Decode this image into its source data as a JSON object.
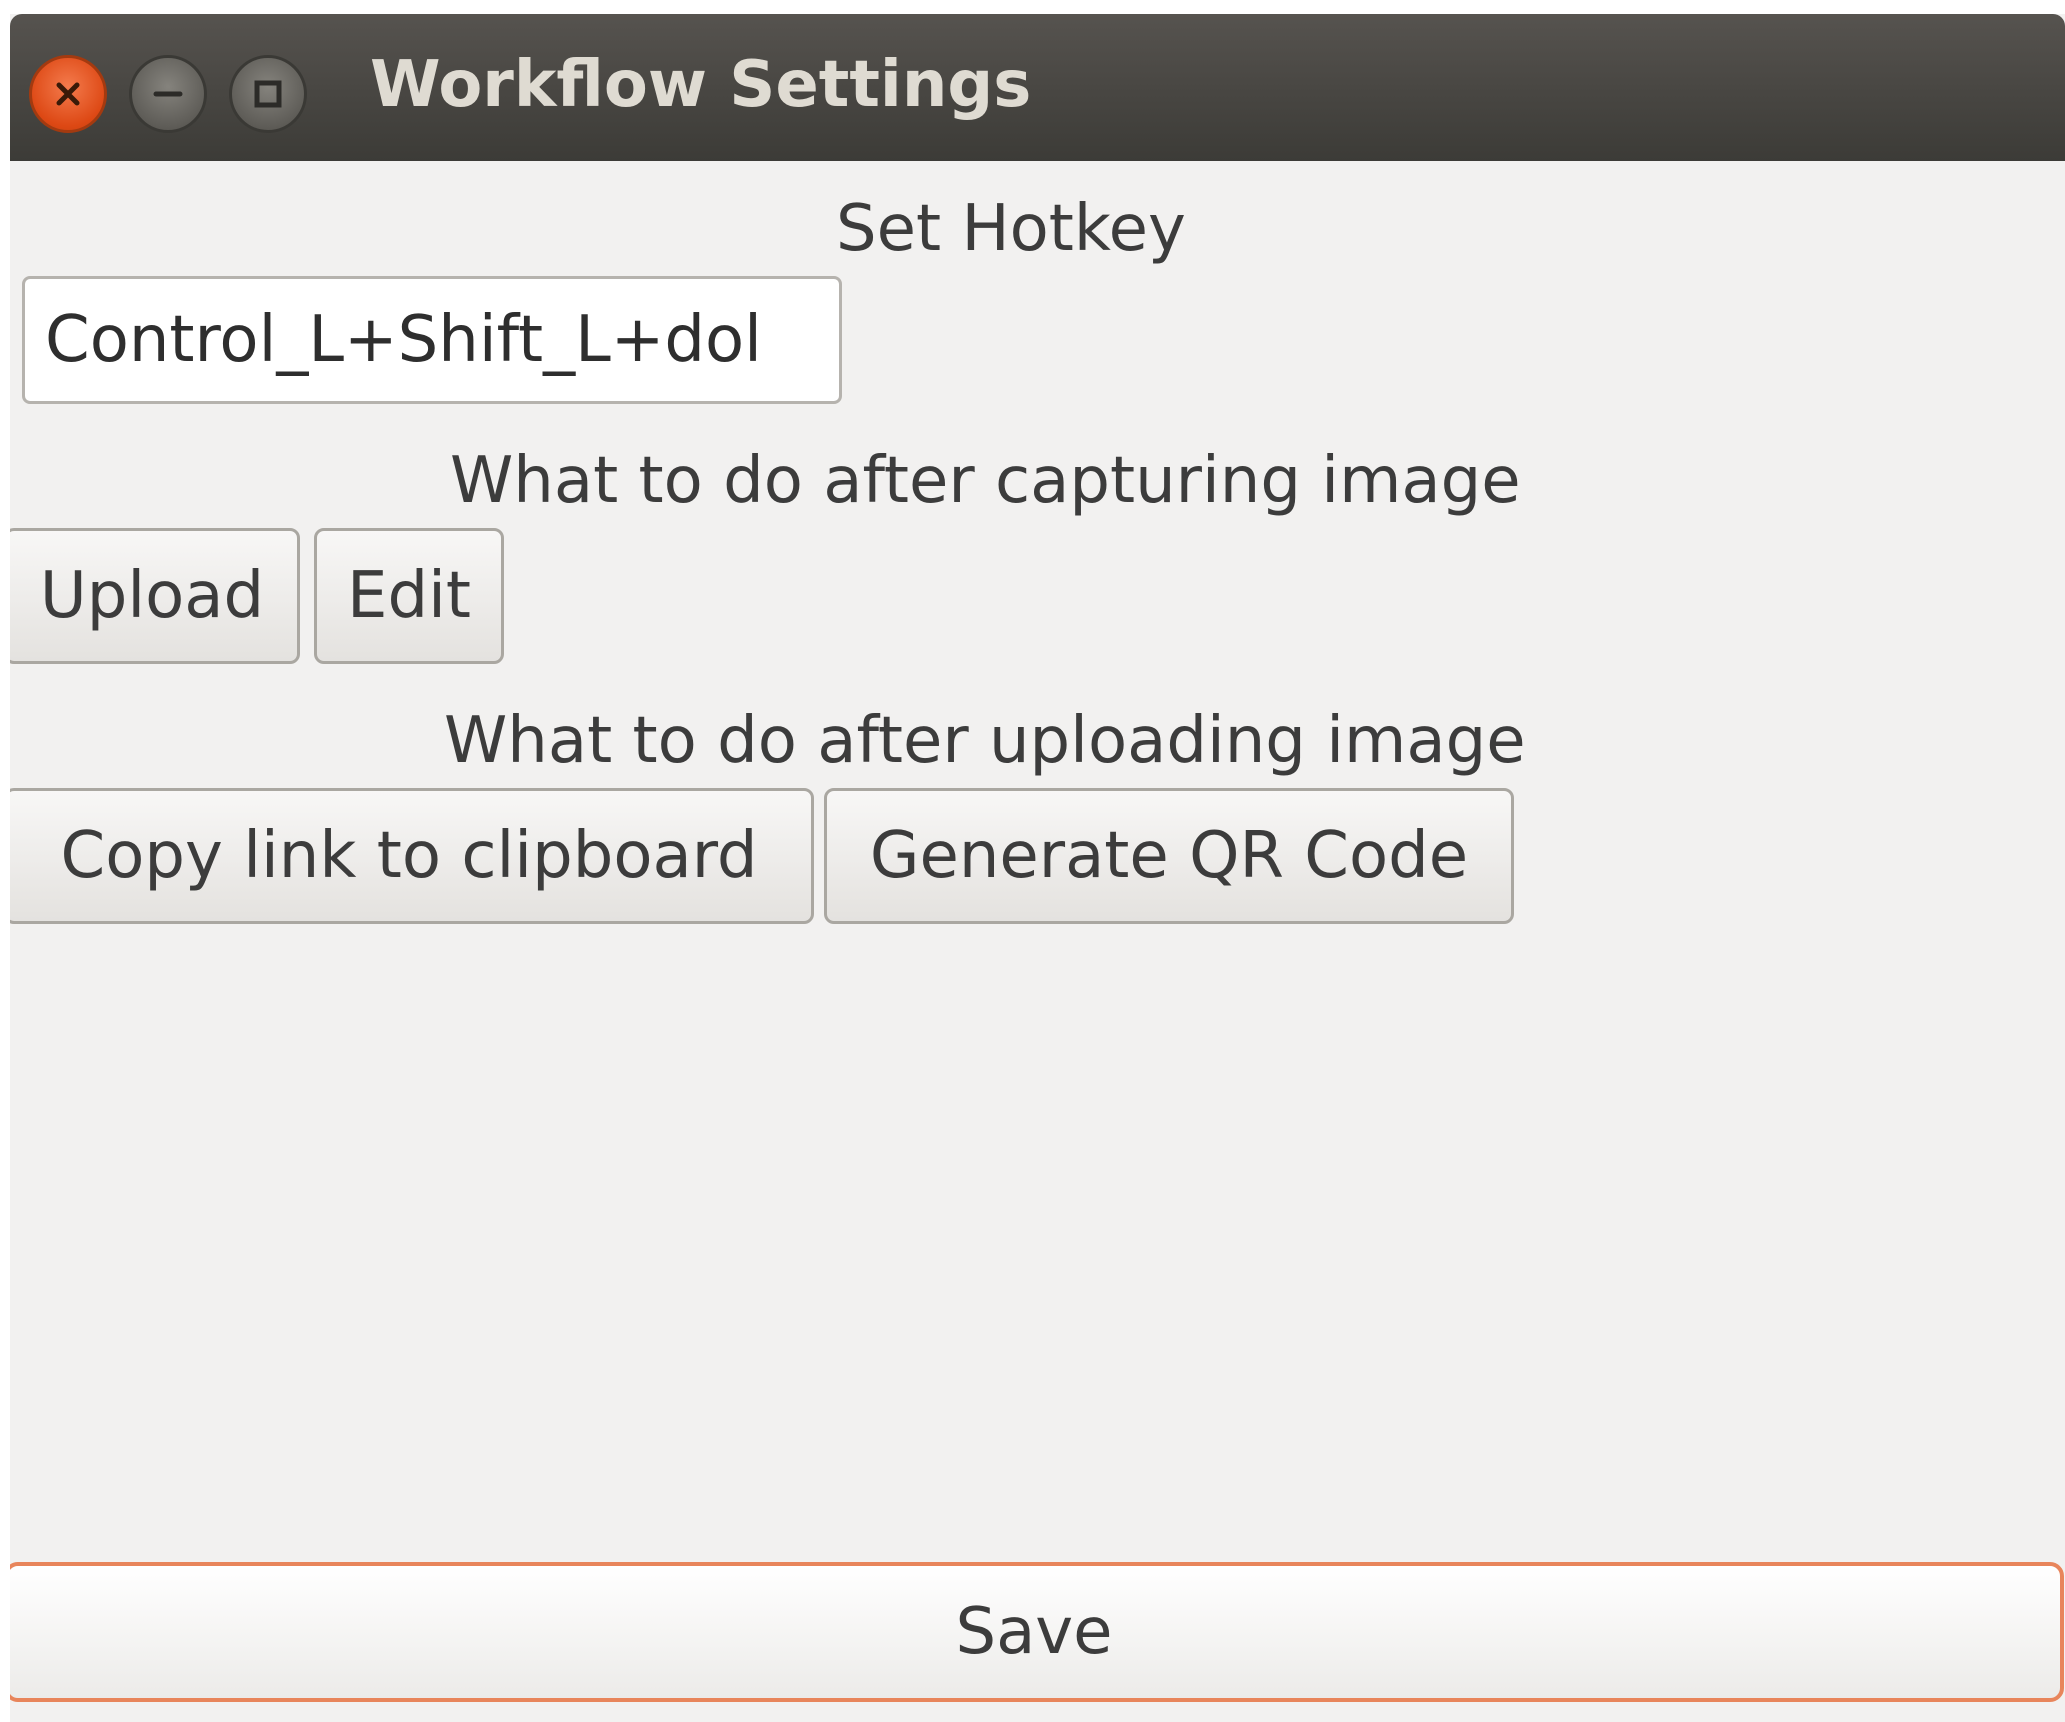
{
  "window": {
    "title": "Workflow Settings"
  },
  "hotkey": {
    "label": "Set Hotkey",
    "value": "Control_L+Shift_L+dol"
  },
  "after_capture": {
    "label": "What to do after capturing image",
    "buttons": [
      "Upload",
      "Edit"
    ]
  },
  "after_upload": {
    "label": "What to do after uploading image",
    "buttons": [
      "Copy link to clipboard",
      "Generate QR Code"
    ]
  },
  "footer": {
    "save_label": "Save"
  },
  "colors": {
    "titlebar": "#3c3b37",
    "close_button": "#dd4814",
    "window_bg": "#f2f1f0",
    "save_border": "#e8855b"
  },
  "icons": [
    "close-icon",
    "minimize-icon",
    "maximize-icon"
  ]
}
